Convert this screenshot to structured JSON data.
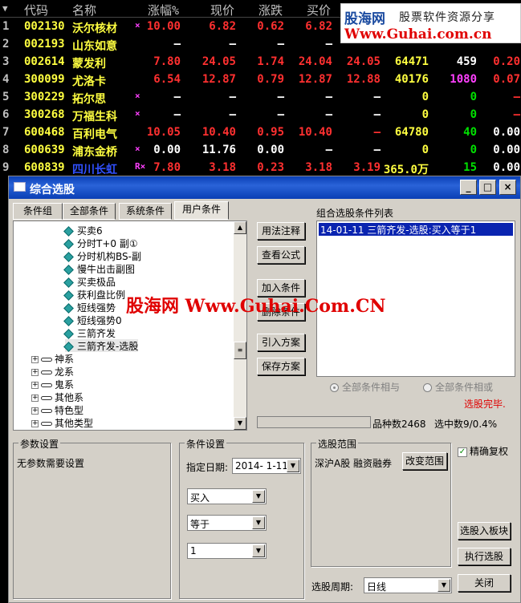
{
  "grid": {
    "headers": [
      "代码",
      "名称",
      "涨幅%",
      "现价",
      "涨跌",
      "买价"
    ],
    "rows": [
      {
        "idx": "1",
        "code": "002130",
        "name": "沃尔核材",
        "mark": "×",
        "pct": "10.00",
        "price": "6.82",
        "chg": "0.62",
        "bid": "6.82",
        "ask": "",
        "vol": "",
        "cur": "",
        "extra": ""
      },
      {
        "idx": "2",
        "code": "002193",
        "name": "山东如意",
        "mark": "",
        "pct": "–",
        "price": "–",
        "chg": "–",
        "bid": "–",
        "ask": "",
        "vol": "",
        "cur": "",
        "extra": ""
      },
      {
        "idx": "3",
        "code": "002614",
        "name": "蒙发利",
        "mark": "",
        "pct": "7.80",
        "price": "24.05",
        "chg": "1.74",
        "bid": "24.04",
        "ask": "24.05",
        "vol": "64471",
        "cur": "459",
        "extra": "0.20"
      },
      {
        "idx": "4",
        "code": "300099",
        "name": "尤洛卡",
        "mark": "",
        "pct": "6.54",
        "price": "12.87",
        "chg": "0.79",
        "bid": "12.87",
        "ask": "12.88",
        "vol": "40176",
        "cur": "1080",
        "extra": "0.07"
      },
      {
        "idx": "5",
        "code": "300229",
        "name": "拓尔思",
        "mark": "×",
        "pct": "–",
        "price": "–",
        "chg": "–",
        "bid": "–",
        "ask": "–",
        "vol": "0",
        "cur": "0",
        "extra": "–"
      },
      {
        "idx": "6",
        "code": "300268",
        "name": "万福生科",
        "mark": "×",
        "pct": "–",
        "price": "–",
        "chg": "–",
        "bid": "–",
        "ask": "–",
        "vol": "0",
        "cur": "0",
        "extra": "–"
      },
      {
        "idx": "7",
        "code": "600468",
        "name": "百利电气",
        "mark": "",
        "pct": "10.05",
        "price": "10.40",
        "chg": "0.95",
        "bid": "10.40",
        "ask": "–",
        "vol": "64780",
        "cur": "40",
        "extra": "0.00"
      },
      {
        "idx": "8",
        "code": "600639",
        "name": "浦东金桥",
        "mark": "×",
        "pct": "0.00",
        "price": "11.76",
        "chg": "0.00",
        "bid": "–",
        "ask": "–",
        "vol": "0",
        "cur": "0",
        "extra": "0.00"
      },
      {
        "idx": "9",
        "code": "600839",
        "name": "四川长虹",
        "mark": "R×",
        "pct": "7.80",
        "price": "3.18",
        "chg": "0.23",
        "bid": "3.18",
        "ask": "3.19",
        "vol": "365.0万",
        "cur": "15",
        "extra": "0.00"
      }
    ]
  },
  "logo": {
    "line1": "股海网",
    "line2": "股票软件资源分享",
    "line3": "Www.Guhai.com.cn"
  },
  "window": {
    "title": "综合选股",
    "tabs": [
      "条件组",
      "全部条件",
      "系统条件",
      "用户条件"
    ],
    "tree": {
      "leaves": [
        "买卖6",
        "分时T+0 副①",
        "分时机构BS-副",
        "慢牛出击副图",
        "买卖极品",
        "获利盘比例",
        "短线强势",
        "短线强势0",
        "三箭齐发",
        "三箭齐发-选股"
      ],
      "groups": [
        "神系",
        "龙系",
        "鬼系",
        "其他系",
        "特色型",
        "其他类型"
      ]
    },
    "buttons": {
      "usage": "用法注释",
      "view": "查看公式",
      "add": "加入条件",
      "del": "删除条件",
      "import": "引入方案",
      "save": "保存方案"
    },
    "list_label": "组合选股条件列表",
    "list_item": "14-01-11 三箭齐发-选股:买入等于1",
    "radio_and": "全部条件相与",
    "radio_or": "全部条件相或",
    "status": "选股完毕.",
    "count_label": "品种数2468",
    "selected_label": "选中数9/0.4%",
    "param_title": "参数设置",
    "param_text": "无参数需要设置",
    "cond_title": "条件设置",
    "date_label": "指定日期:",
    "date_value": "2014- 1-11",
    "combo1": "买入",
    "combo2": "等于",
    "combo3": "1",
    "range_title": "选股范围",
    "range_text": "深沪A股 融资融券",
    "range_btn": "改变范围",
    "exact_label": "精确复权",
    "to_block": "选股入板块",
    "execute": "执行选股",
    "close": "关闭",
    "period_label": "选股周期:",
    "period_value": "日线"
  },
  "watermark": "股海网 Www.Guhai.Com.CN",
  "colors": {
    "red": "#ff3030",
    "green": "#00e000",
    "yellow": "#ffff40",
    "cyan": "#40e0e0",
    "magenta": "#ff40ff"
  }
}
